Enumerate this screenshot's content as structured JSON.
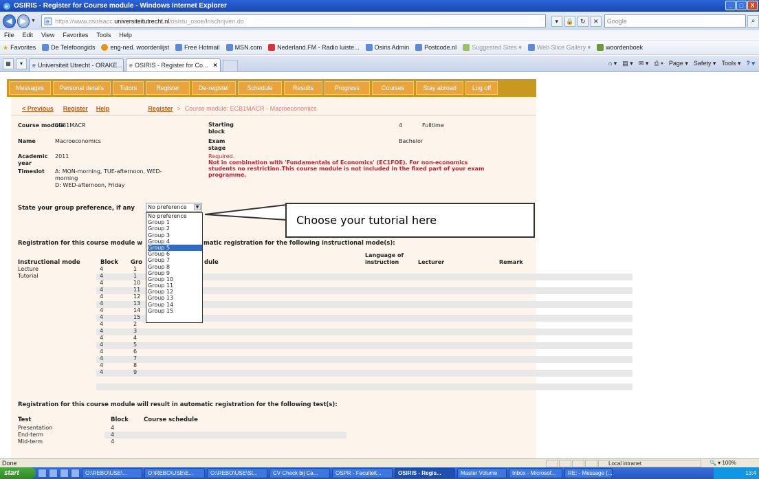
{
  "window": {
    "title": "OSIRIS - Register for Course module - Windows Internet Explorer",
    "controls": [
      "_",
      "□",
      "X"
    ]
  },
  "address": {
    "url_prefix": "https://www.osirisacc.",
    "url_domain": "universiteitutrecht.nl",
    "url_path": "/osistu_osoe/Inschrijven.do",
    "search_placeholder": "Google"
  },
  "menubar": [
    "File",
    "Edit",
    "View",
    "Favorites",
    "Tools",
    "Help"
  ],
  "favorites": {
    "label": "Favorites",
    "items": [
      "De Telefoongids",
      "eng-ned. woordenlijst",
      "Free Hotmail",
      "MSN.com",
      "Nederland.FM - Radio luiste...",
      "Osiris Admin",
      "Postcode.nl",
      "Suggested Sites ▾",
      "Web Slice Gallery ▾",
      "woordenboek"
    ]
  },
  "tabs": [
    {
      "label": "Universiteit Utrecht - ORAKE..."
    },
    {
      "label": "OSIRIS - Register for Co..."
    }
  ],
  "command_bar": [
    "Page ▾",
    "Safety ▾",
    "Tools ▾"
  ],
  "nav_menu": [
    "Messages",
    "Personal details",
    "Tutors",
    "Register",
    "De-register",
    "Schedule",
    "Results",
    "Progress",
    "Courses",
    "Stay abroad",
    "Log off"
  ],
  "breadcrumbs": {
    "previous": "< Previous",
    "register": "Register",
    "help": "Help",
    "crumb_register": "Register",
    "sep": ">",
    "crumb_current": "Course module: ECB1MACR - Macroeconomics"
  },
  "details": {
    "course_module_label": "Course module",
    "course_module_value": "ECB1MACR",
    "name_label": "Name",
    "name_value": "Macroeconomics",
    "academic_year_label": "Academic year",
    "academic_year_value": "2011",
    "timeslot_label": "Timeslot",
    "timeslot_lines": [
      "A: MON-morning, TUE-afternoon, WED-",
      "morning",
      "D: WED-afternoon, Friday"
    ],
    "starting_block_label": "Starting block",
    "starting_block_value": "4",
    "fulltime": "Fulltime",
    "exam_stage_label": "Exam stage",
    "exam_stage_value": "Bachelor",
    "required_lines": [
      "Required.",
      "Not in combination with 'Fundamentals of Economics' (EC1FOE). For non-economics",
      "students no restriction.This course module is not included in the fixed part of your exam",
      "programme."
    ]
  },
  "group_pref": {
    "label": "State your group preference, if any",
    "selected": "No preference",
    "options": [
      "No preference",
      "Group 1",
      "Group 2",
      "Group 3",
      "Group 4",
      "Group 5",
      "Group 6",
      "Group 7",
      "Group 8",
      "Group 9",
      "Group 10",
      "Group 11",
      "Group 12",
      "Group 13",
      "Group 14",
      "Group 15"
    ],
    "highlighted_index": 5
  },
  "callout_text": "Choose your tutorial here",
  "instr_section": {
    "heading_left": "Registration for this course module w",
    "heading_right": "matic registration for the following instructional mode(s):",
    "col_mode": "Instructional mode",
    "col_block": "Block",
    "col_group": "Gro",
    "col_schedule": "dule",
    "col_language_1": "Language of",
    "col_language_2": "instruction",
    "col_lecturer": "Lecturer",
    "col_remark": "Remark",
    "rows": [
      {
        "mode": "Lecture",
        "block": "4",
        "group": "1"
      },
      {
        "mode": "Tutorial",
        "block": "4",
        "group": "1"
      },
      {
        "mode": "",
        "block": "4",
        "group": "10"
      },
      {
        "mode": "",
        "block": "4",
        "group": "11"
      },
      {
        "mode": "",
        "block": "4",
        "group": "12"
      },
      {
        "mode": "",
        "block": "4",
        "group": "13"
      },
      {
        "mode": "",
        "block": "4",
        "group": "14"
      },
      {
        "mode": "",
        "block": "4",
        "group": "15"
      },
      {
        "mode": "",
        "block": "4",
        "group": "2"
      },
      {
        "mode": "",
        "block": "4",
        "group": "3"
      },
      {
        "mode": "",
        "block": "4",
        "group": "4"
      },
      {
        "mode": "",
        "block": "4",
        "group": "5"
      },
      {
        "mode": "",
        "block": "4",
        "group": "6"
      },
      {
        "mode": "",
        "block": "4",
        "group": "7"
      },
      {
        "mode": "",
        "block": "4",
        "group": "8"
      },
      {
        "mode": "",
        "block": "4",
        "group": "9"
      }
    ]
  },
  "test_section": {
    "heading": "Registration for this course module will result in automatic registration for the following test(s):",
    "col_test": "Test",
    "col_block": "Block",
    "col_schedule": "Course schedule",
    "rows": [
      {
        "test": "Presentation",
        "block": "4"
      },
      {
        "test": "End-term",
        "block": "4"
      },
      {
        "test": "Mid-term",
        "block": "4"
      }
    ]
  },
  "status": {
    "left": "Done",
    "zone": "Local intranet",
    "zoom": "100%"
  },
  "taskbar": {
    "start": "start",
    "buttons": [
      "O:\\REBO\\USE\\...",
      "O:\\REBO\\USE\\E...",
      "O:\\REBO\\USE\\St...",
      "CV Check bij Ca...",
      "OSPR - Faculteit...",
      "OSIRIS - Regis...",
      "Master Volume",
      "Inbox - Microsof...",
      "RE: - Message (..."
    ],
    "active_index": 5,
    "clock": "13:4"
  },
  "colors": {
    "nav_bg": "#c79a1f",
    "nav_button": "#e9a53c",
    "content_bg": "#fdf5ec",
    "required_red": "#cc1c2c",
    "link_brown": "#b65a16"
  }
}
